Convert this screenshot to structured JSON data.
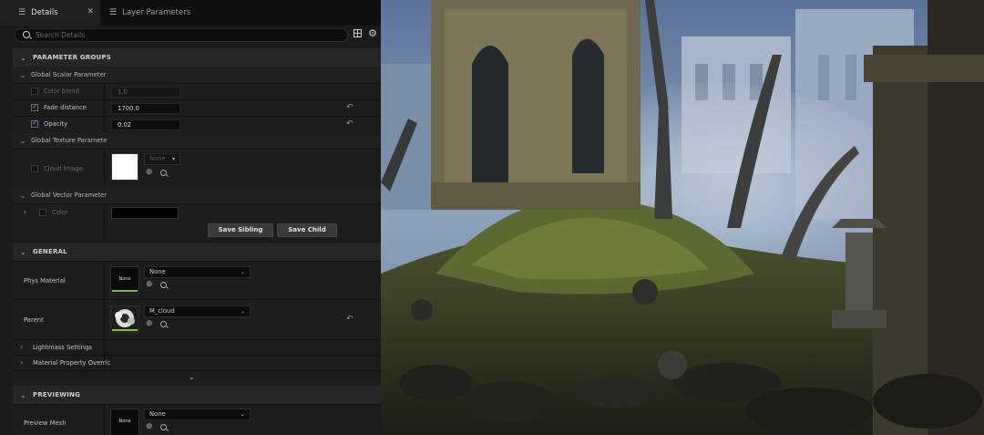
{
  "tabs": [
    {
      "label": "Details",
      "icon": "details-icon",
      "active": true
    },
    {
      "label": "Layer Parameters",
      "icon": "layers-icon",
      "active": false
    }
  ],
  "search": {
    "placeholder": "Search Details"
  },
  "sections": {
    "parameter_groups": "PARAMETER GROUPS",
    "general": "GENERAL",
    "previewing": "PREVIEWING"
  },
  "groups": {
    "scalar": "Global Scalar Parameter",
    "texture": "Global Texture Paramete",
    "vector": "Global Vector Parameter"
  },
  "params": {
    "color_blend": {
      "label": "Color blend",
      "value": "1.0",
      "checked": false
    },
    "fade_distance": {
      "label": "Fade distance",
      "value": "1700.0",
      "checked": true
    },
    "opacity": {
      "label": "Opacity",
      "value": "0.02",
      "checked": true
    },
    "cloud_image": {
      "label": "Cloud Image",
      "dropdown": "None",
      "checked": false
    },
    "color": {
      "label": "Color",
      "swatch": "#000000",
      "checked": false
    }
  },
  "buttons": {
    "save_sibling": "Save Sibling",
    "save_child": "Save Child"
  },
  "general": {
    "phys_material": {
      "label": "Phys Material",
      "thumb_text": "None",
      "value": "None"
    },
    "parent": {
      "label": "Parent",
      "value": "M_cloud"
    },
    "lightmass": "Lightmass Settings",
    "material_property": "Material Property Overric"
  },
  "previewing": {
    "preview_mesh": {
      "label": "Preview Mesh",
      "thumb_text": "None",
      "value": "None"
    }
  },
  "colors": {
    "accent": "#4aa0ff",
    "thumb_bar": "#78c23a",
    "panel_bg": "#1a1a1a"
  }
}
